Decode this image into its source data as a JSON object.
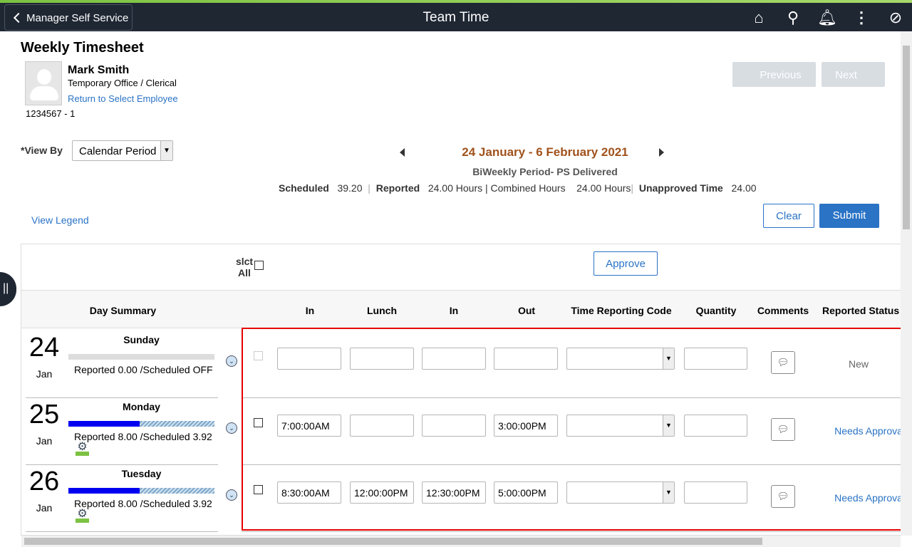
{
  "header": {
    "back_label": "Manager Self Service",
    "title": "Team Time",
    "icons": [
      "home-icon",
      "search-icon",
      "bell-icon",
      "more-icon",
      "compass-icon"
    ]
  },
  "page": {
    "title": "Weekly Timesheet"
  },
  "employee": {
    "name": "Mark Smith",
    "job": "Temporary Office / Clerical",
    "return_link": "Return to Select Employee",
    "id": "1234567 - 1"
  },
  "nav": {
    "previous": "Previous",
    "next": "Next"
  },
  "view_by": {
    "label": "*View By",
    "value": "Calendar Period"
  },
  "period": {
    "range": "24 January - 6 February 2021",
    "type": "BiWeekly Period- PS Delivered",
    "range_color": "#a0521c"
  },
  "summary": {
    "scheduled_label": "Scheduled",
    "scheduled": "39.20",
    "reported_label": "Reported",
    "reported": "24.00 Hours | Combined Hours",
    "combined": "24.00 Hours",
    "unapproved_label": "Unapproved Time",
    "unapproved": "24.00"
  },
  "actions": {
    "view_legend": "View Legend",
    "clear": "Clear",
    "submit": "Submit",
    "approve": "Approve",
    "select_all": "slct All"
  },
  "columns": [
    "Day Summary",
    "In",
    "Lunch",
    "In",
    "Out",
    "Time Reporting Code",
    "Quantity",
    "Comments",
    "Reported Status"
  ],
  "rows": [
    {
      "day": "24",
      "month": "Jan",
      "weekday": "Sunday",
      "summary": "Reported 0.00 /Scheduled OFF",
      "reported_fraction": 0,
      "in": "",
      "lunch": "",
      "in2": "",
      "out": "",
      "trc": "",
      "quantity": "",
      "status": "New",
      "status_link": false,
      "disabled": true,
      "icon": false
    },
    {
      "day": "25",
      "month": "Jan",
      "weekday": "Monday",
      "summary": "Reported 8.00 /Scheduled 3.92",
      "reported_fraction": 0.49,
      "in": "7:00:00AM",
      "lunch": "",
      "in2": "",
      "out": "3:00:00PM",
      "trc": "",
      "quantity": "",
      "status": "Needs Approval",
      "status_link": true,
      "disabled": false,
      "icon": true
    },
    {
      "day": "26",
      "month": "Jan",
      "weekday": "Tuesday",
      "summary": "Reported 8.00 /Scheduled 3.92",
      "reported_fraction": 0.49,
      "in": "8:30:00AM",
      "lunch": "12:00:00PM",
      "in2": "12:30:00PM",
      "out": "5:00:00PM",
      "trc": "",
      "quantity": "",
      "status": "Needs Approval",
      "status_link": true,
      "disabled": false,
      "icon": true
    }
  ]
}
